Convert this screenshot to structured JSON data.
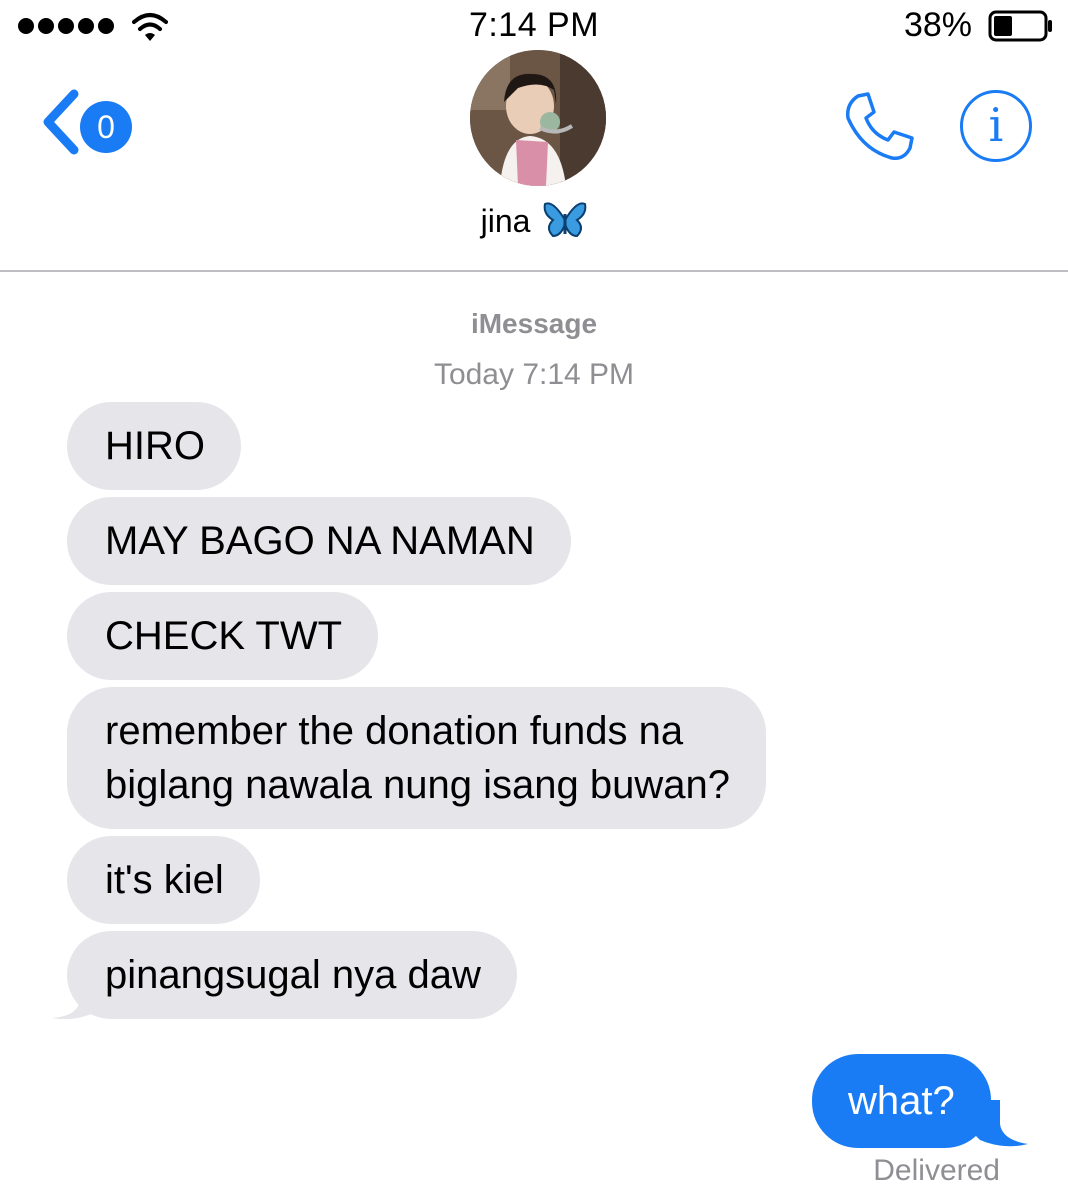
{
  "status_bar": {
    "time": "7:14 PM",
    "battery_percent": "38%",
    "battery_level": 0.38,
    "signal_bars": 5
  },
  "header": {
    "back_badge_count": "0",
    "contact_name": "jina",
    "contact_emoji_icon": "blue-butterfly-icon",
    "accent_color": "#1a7cf5"
  },
  "thread": {
    "service": "iMessage",
    "timestamp": "Today 7:14 PM",
    "incoming_messages": [
      {
        "text": "HIRO"
      },
      {
        "text": "MAY BAGO NA NAMAN"
      },
      {
        "text": "CHECK TWT"
      },
      {
        "line1": "remember the donation funds na",
        "line2": "biglang nawala nung isang buwan?"
      },
      {
        "text": "it's kiel"
      },
      {
        "text": "pinangsugal nya daw"
      }
    ],
    "outgoing_messages": [
      {
        "text": "what?"
      }
    ],
    "delivery_status": "Delivered",
    "incoming_bubble_color": "#e5e5ea",
    "outgoing_bubble_color": "#1a7cf5"
  }
}
